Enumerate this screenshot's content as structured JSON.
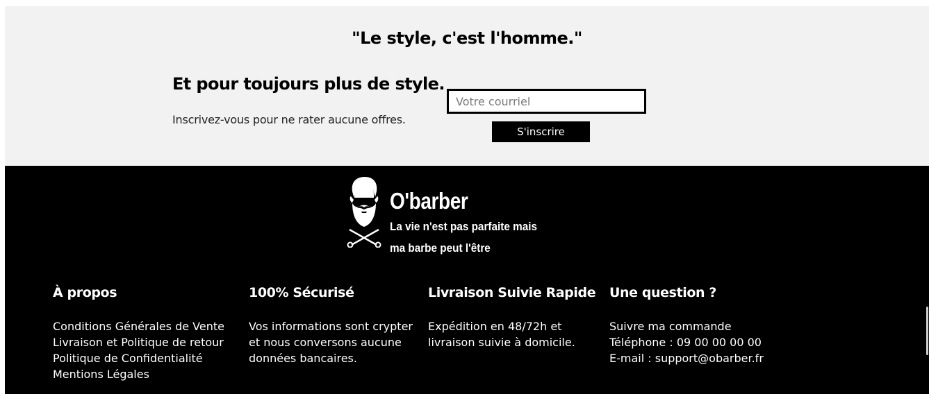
{
  "newsletter": {
    "quote": "\"Le style, c'est l'homme.\"",
    "title": "Et pour toujours plus de style.",
    "subtitle": "Inscrivez-vous pour ne rater aucune offres.",
    "email_placeholder": "Votre courriel",
    "subscribe_label": "S'inscrire"
  },
  "brand": {
    "name": "O'barber",
    "tagline_line1": "La vie n'est pas parfaite mais",
    "tagline_line2": "ma barbe peut l'être",
    "logo_icon": "bearded-man-scissors-icon"
  },
  "footer": {
    "about": {
      "title": "À propos",
      "links": [
        "Conditions Générales de Vente",
        "Livraison et Politique de retour",
        "Politique de Confidentialité",
        "Mentions Légales"
      ]
    },
    "secure": {
      "title": "100% Sécurisé",
      "text": "Vos informations sont crypter et nous conversons aucune données bancaires."
    },
    "delivery": {
      "title": "Livraison Suivie Rapide",
      "text": "Expédition en 48/72h et livraison suivie à domicile."
    },
    "question": {
      "title": "Une question ?",
      "items": [
        "Suivre ma commande",
        "Téléphone : 09 00 00 00 00",
        "E-mail : support@obarber.fr"
      ]
    }
  },
  "colors": {
    "newsletter_bg": "#f2f2f2",
    "footer_bg": "#000000",
    "button_bg": "#000000",
    "text_light": "#ffffff"
  }
}
